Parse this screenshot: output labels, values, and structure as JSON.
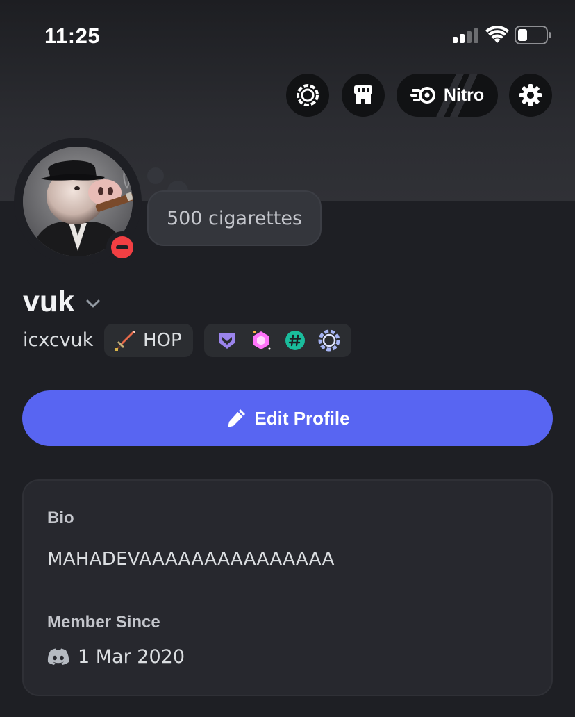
{
  "status_bar": {
    "time": "11:25"
  },
  "header": {
    "nitro_label": "Nitro"
  },
  "profile": {
    "custom_status": "500 cigarettes",
    "display_name": "vuk",
    "username": "icxcvuk",
    "guild_tag": "HOP",
    "badges": [
      "hypesquad-balance-icon",
      "nitro-gem-icon",
      "hash-badge-icon",
      "nitro-wreath-icon"
    ],
    "status": "do-not-disturb"
  },
  "actions": {
    "edit_profile": "Edit Profile"
  },
  "about": {
    "bio_heading": "Bio",
    "bio": "MAHADEVAAAAAAAAAAAAAAA",
    "member_since_heading": "Member Since",
    "member_since": "1 Mar 2020"
  },
  "colors": {
    "accent": "#5865f2",
    "dnd": "#f23f43",
    "background": "#1e1f24",
    "card": "#27282e"
  }
}
